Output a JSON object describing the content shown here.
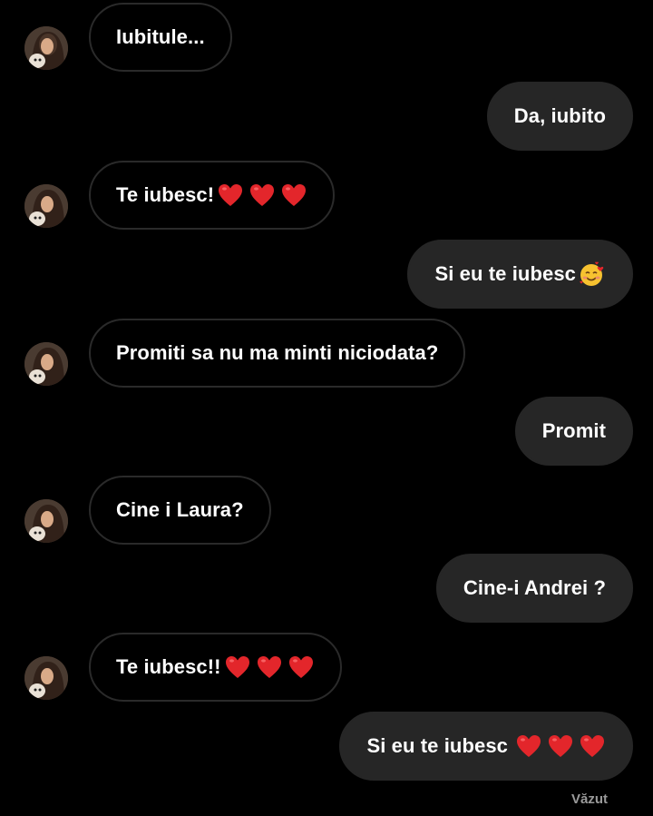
{
  "messages": [
    {
      "from": "contact",
      "text": "Iubitule...",
      "hearts": 0
    },
    {
      "from": "me",
      "text": "Da, iubito",
      "hearts": 0
    },
    {
      "from": "contact",
      "text": "Te iubesc!",
      "hearts": 3
    },
    {
      "from": "me",
      "text": "Si eu te iubesc",
      "emoji": "smiling-face-with-hearts"
    },
    {
      "from": "contact",
      "text": "Promiti sa nu ma minti niciodata?",
      "hearts": 0
    },
    {
      "from": "me",
      "text": "Promit",
      "hearts": 0
    },
    {
      "from": "contact",
      "text": "Cine i Laura?",
      "hearts": 0
    },
    {
      "from": "me",
      "text": "Cine-i Andrei ?",
      "hearts": 0
    },
    {
      "from": "contact",
      "text": "Te iubesc!!",
      "hearts": 3
    },
    {
      "from": "me",
      "text": "Si eu te iubesc ",
      "hearts": 3
    }
  ],
  "seen_label": "Văzut",
  "colors": {
    "background": "#000000",
    "outgoing_bubble": "#262626",
    "incoming_border": "#2a2a2a",
    "heart": "#e3262b",
    "seen_text": "#9a9a9a"
  },
  "icons": {
    "heart": "red-heart-icon",
    "emoji": "smiling-face-with-hearts-icon",
    "avatar": "contact-avatar"
  }
}
